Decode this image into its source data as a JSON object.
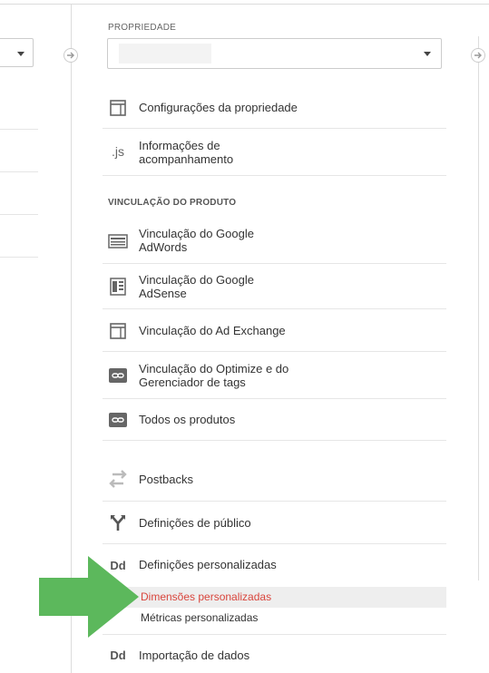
{
  "property": {
    "label": "PROPRIEDADE",
    "selected_value": ""
  },
  "menu": {
    "settings": "Configurações da propriedade",
    "tracking_line1": "Informações de",
    "tracking_line2": "acompanhamento",
    "tracking_icon_text": ".js"
  },
  "product_linking": {
    "header": "VINCULAÇÃO DO PRODUTO",
    "adwords_line1": "Vinculação do Google",
    "adwords_line2": "AdWords",
    "adsense_line1": "Vinculação do Google",
    "adsense_line2": "AdSense",
    "adexchange": "Vinculação do Ad Exchange",
    "optimize_line1": "Vinculação do Optimize e do",
    "optimize_line2": "Gerenciador de tags",
    "all_products": "Todos os produtos"
  },
  "other": {
    "postbacks": "Postbacks",
    "audience": "Definições de público",
    "custom_defs": "Definições personalizadas",
    "custom_icon_text": "Dd",
    "custom_dimensions": "Dimensões personalizadas",
    "custom_metrics": "Métricas personalizadas",
    "data_import": "Importação de dados",
    "data_import_icon_text": "Dd"
  },
  "colors": {
    "active": "#d9453c",
    "arrow": "#5cb85c"
  }
}
